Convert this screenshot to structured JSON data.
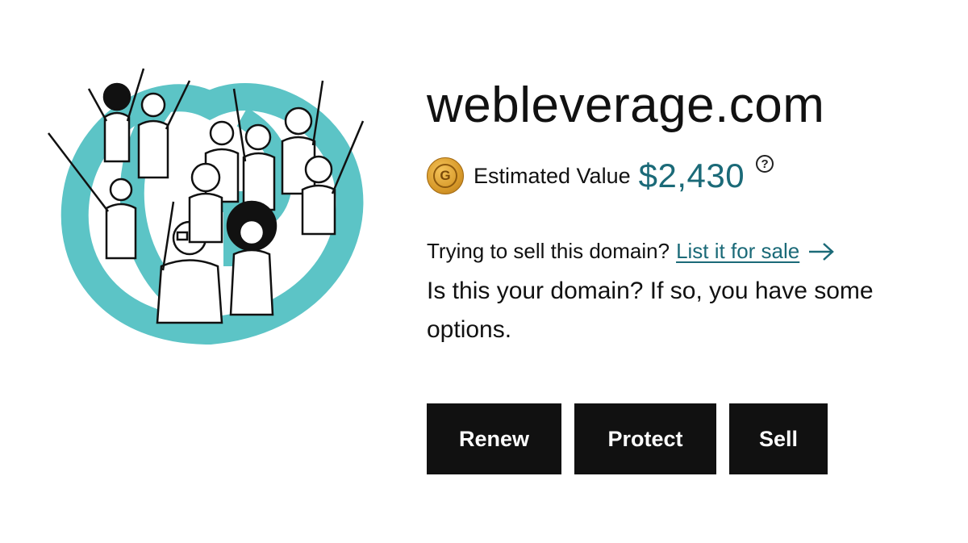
{
  "domain": {
    "name": "webleverage.com"
  },
  "valuation": {
    "coin_letter": "G",
    "label": "Estimated Value",
    "amount": "$2,430",
    "help_symbol": "?"
  },
  "sell_prompt": {
    "question": "Trying to sell this domain?",
    "link_label": "List it for sale"
  },
  "owner_prompt": {
    "text": "Is this your domain? If so, you have some options."
  },
  "actions": {
    "renew_label": "Renew",
    "protect_label": "Protect",
    "sell_label": "Sell"
  },
  "illustration": {
    "icon": "crowd-illustration",
    "ring_color": "#5cc4c6"
  },
  "colors": {
    "accent": "#1b6a78",
    "button_bg": "#111111",
    "coin": "#d89a2a"
  }
}
